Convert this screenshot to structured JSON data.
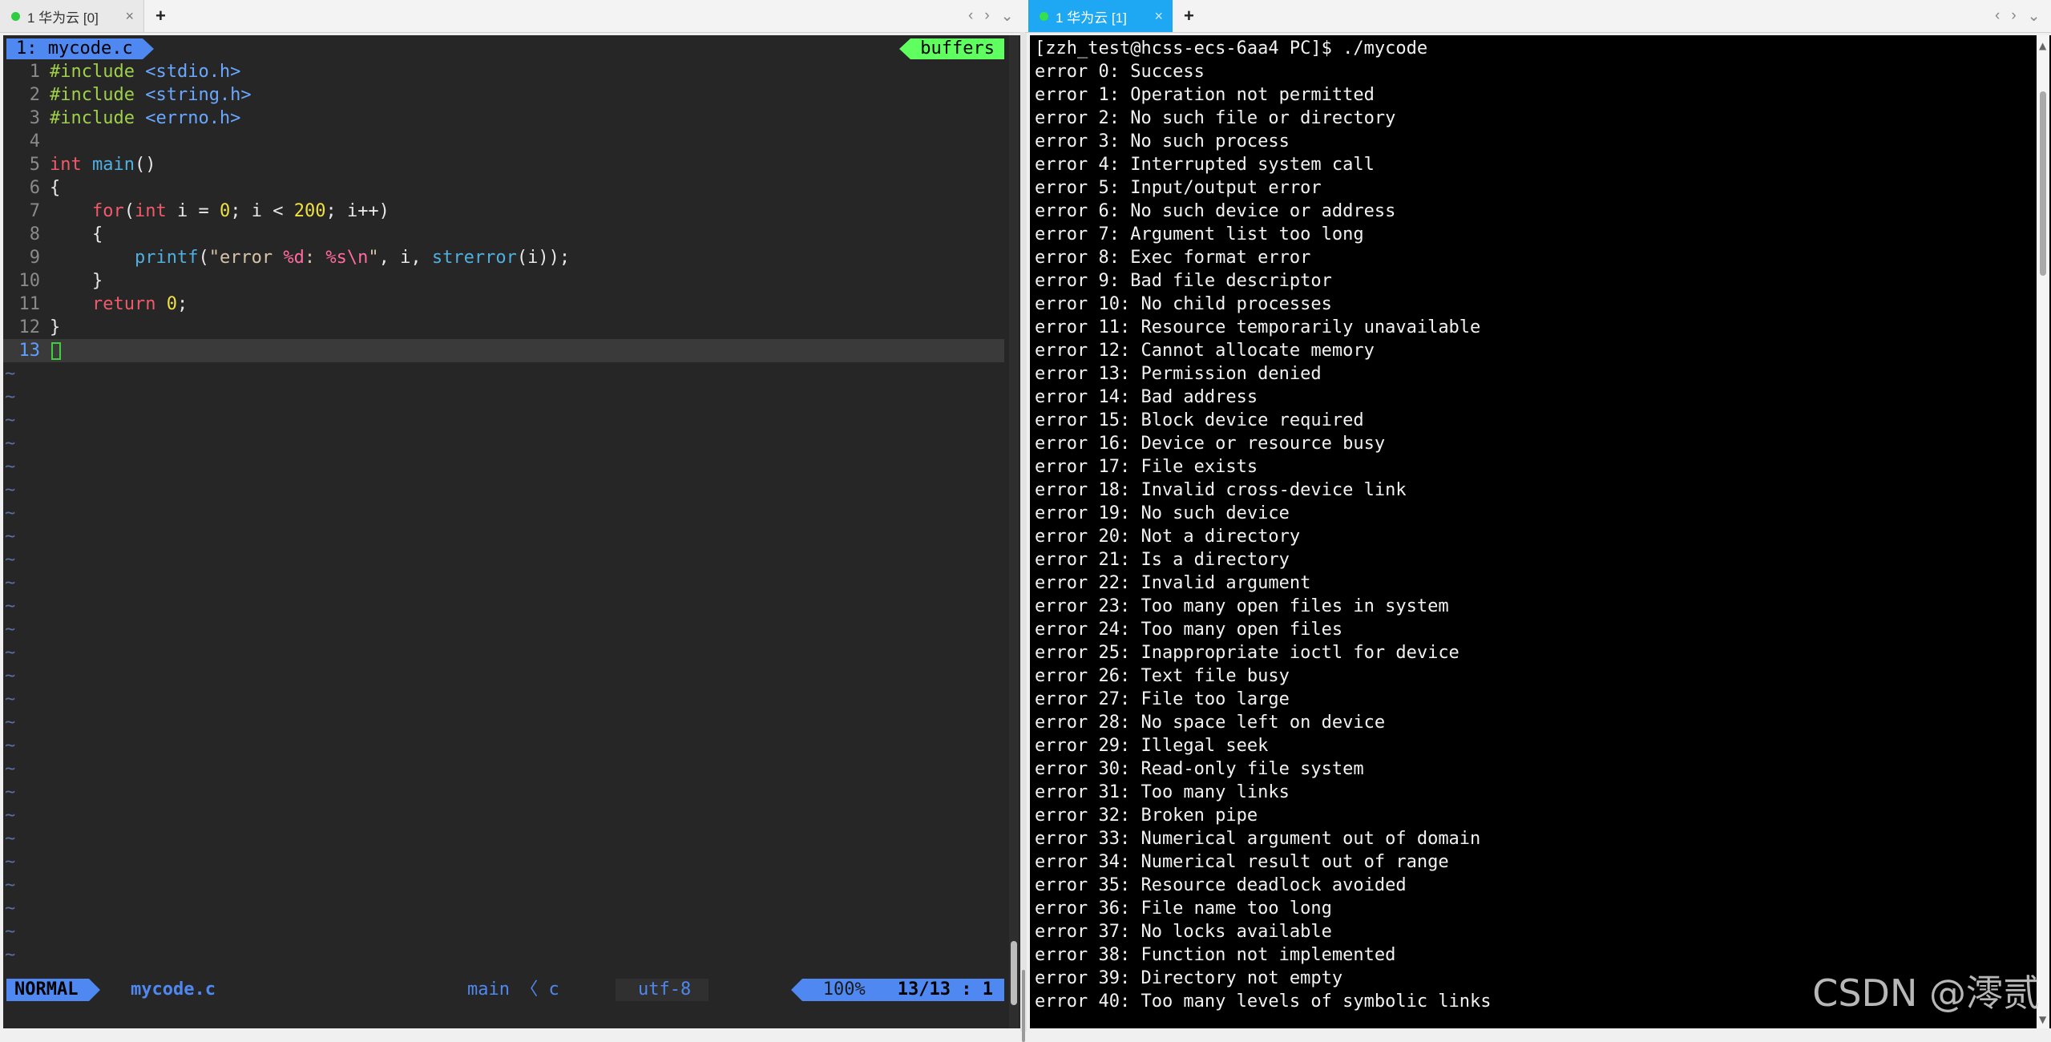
{
  "tabs": {
    "left": {
      "label": "1 华为云 [0]",
      "close": "×",
      "new": "+",
      "nav_left": "‹",
      "nav_right": "›",
      "menu": "⌄"
    },
    "right": {
      "label": "1 华为云 [1]",
      "close": "×",
      "new": "+",
      "nav_left": "‹",
      "nav_right": "›",
      "menu": "⌄"
    }
  },
  "vim": {
    "buffer_tab": "1: mycode.c",
    "buffers_label": "buffers",
    "code_lines": [
      "#include <stdio.h>",
      "#include <string.h>",
      "#include <errno.h>",
      "",
      "int main()",
      "{",
      "    for(int i = 0; i < 200; i++)",
      "    {",
      "        printf(\"error %d: %s\\n\", i, strerror(i));",
      "    }",
      "    return 0;",
      "}",
      ""
    ],
    "tilde_count": 26,
    "tilde_char": "~",
    "status": {
      "mode": "NORMAL",
      "file": "mycode.c",
      "function": "main 〈 c",
      "encoding": "utf-8",
      "percent": "100%",
      "position": "13/13 :  1"
    }
  },
  "terminal": {
    "prompt": "[zzh_test@hcss-ecs-6aa4 PC]$ ./mycode",
    "lines": [
      "error 0: Success",
      "error 1: Operation not permitted",
      "error 2: No such file or directory",
      "error 3: No such process",
      "error 4: Interrupted system call",
      "error 5: Input/output error",
      "error 6: No such device or address",
      "error 7: Argument list too long",
      "error 8: Exec format error",
      "error 9: Bad file descriptor",
      "error 10: No child processes",
      "error 11: Resource temporarily unavailable",
      "error 12: Cannot allocate memory",
      "error 13: Permission denied",
      "error 14: Bad address",
      "error 15: Block device required",
      "error 16: Device or resource busy",
      "error 17: File exists",
      "error 18: Invalid cross-device link",
      "error 19: No such device",
      "error 20: Not a directory",
      "error 21: Is a directory",
      "error 22: Invalid argument",
      "error 23: Too many open files in system",
      "error 24: Too many open files",
      "error 25: Inappropriate ioctl for device",
      "error 26: Text file busy",
      "error 27: File too large",
      "error 28: No space left on device",
      "error 29: Illegal seek",
      "error 30: Read-only file system",
      "error 31: Too many links",
      "error 32: Broken pipe",
      "error 33: Numerical argument out of domain",
      "error 34: Numerical result out of range",
      "error 35: Resource deadlock avoided",
      "error 36: File name too long",
      "error 37: No locks available",
      "error 38: Function not implemented",
      "error 39: Directory not empty",
      "error 40: Too many levels of symbolic links"
    ],
    "scroll_up": "▲",
    "scroll_down": "▼"
  },
  "watermark": "CSDN @澪贰",
  "colors": {
    "tab_active": "#1ea7f2",
    "vim_accent": "#4f88f0",
    "buffers_green": "#5fff5f",
    "terminal_bg": "#000000",
    "vim_bg": "#262626"
  }
}
